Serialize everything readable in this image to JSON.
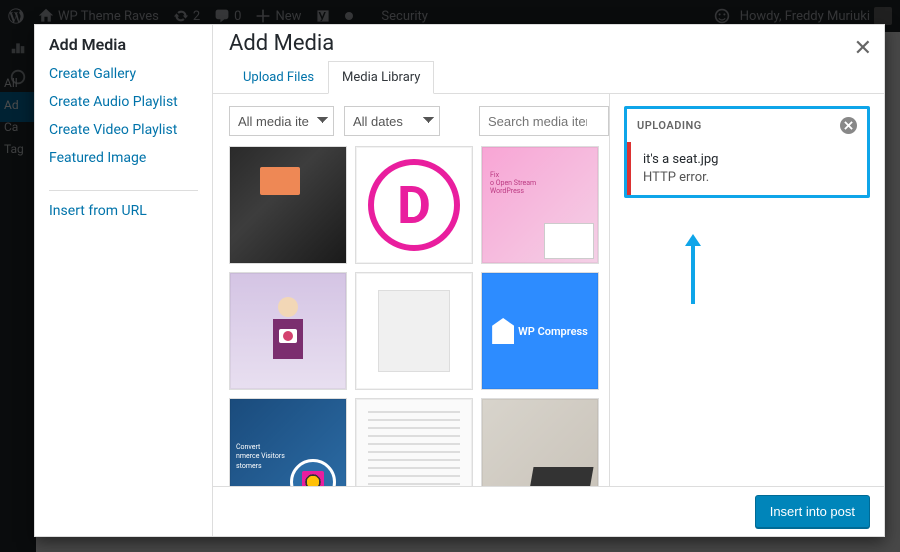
{
  "adminbar": {
    "site_name": "WP Theme Raves",
    "updates_count": "2",
    "comments_count": "0",
    "new_label": "New",
    "security_label": "Security",
    "howdy": "Howdy, Freddy Muriuki"
  },
  "leftmenu": {
    "items": [
      "All",
      "Ad",
      "Ca",
      "Tag"
    ]
  },
  "modal": {
    "media_menu": {
      "title": "Add Media",
      "items": [
        "Create Gallery",
        "Create Audio Playlist",
        "Create Video Playlist",
        "Featured Image"
      ],
      "secondary": [
        "Insert from URL"
      ]
    },
    "frame_title": "Add Media",
    "router": {
      "upload": "Upload Files",
      "library": "Media Library"
    },
    "filters": {
      "type_label": "All media items",
      "date_label": "All dates",
      "search_placeholder": "Search media items..."
    },
    "sidebar": {
      "uploading_label": "UPLOADING",
      "error_item": {
        "filename": "it's a seat.jpg",
        "message": "HTTP error."
      }
    },
    "thumb_d_text": "D",
    "thumb3_line1": "Fix",
    "thumb3_line2": "o Open Stream",
    "thumb3_line3": "WordPress",
    "thumb6_text": "WP Compress",
    "thumb7_line1": "Convert",
    "thumb7_line2": "nmerce Visitors",
    "thumb7_line3": "stomers",
    "footer_button": "Insert into post",
    "close_label": "✕"
  }
}
